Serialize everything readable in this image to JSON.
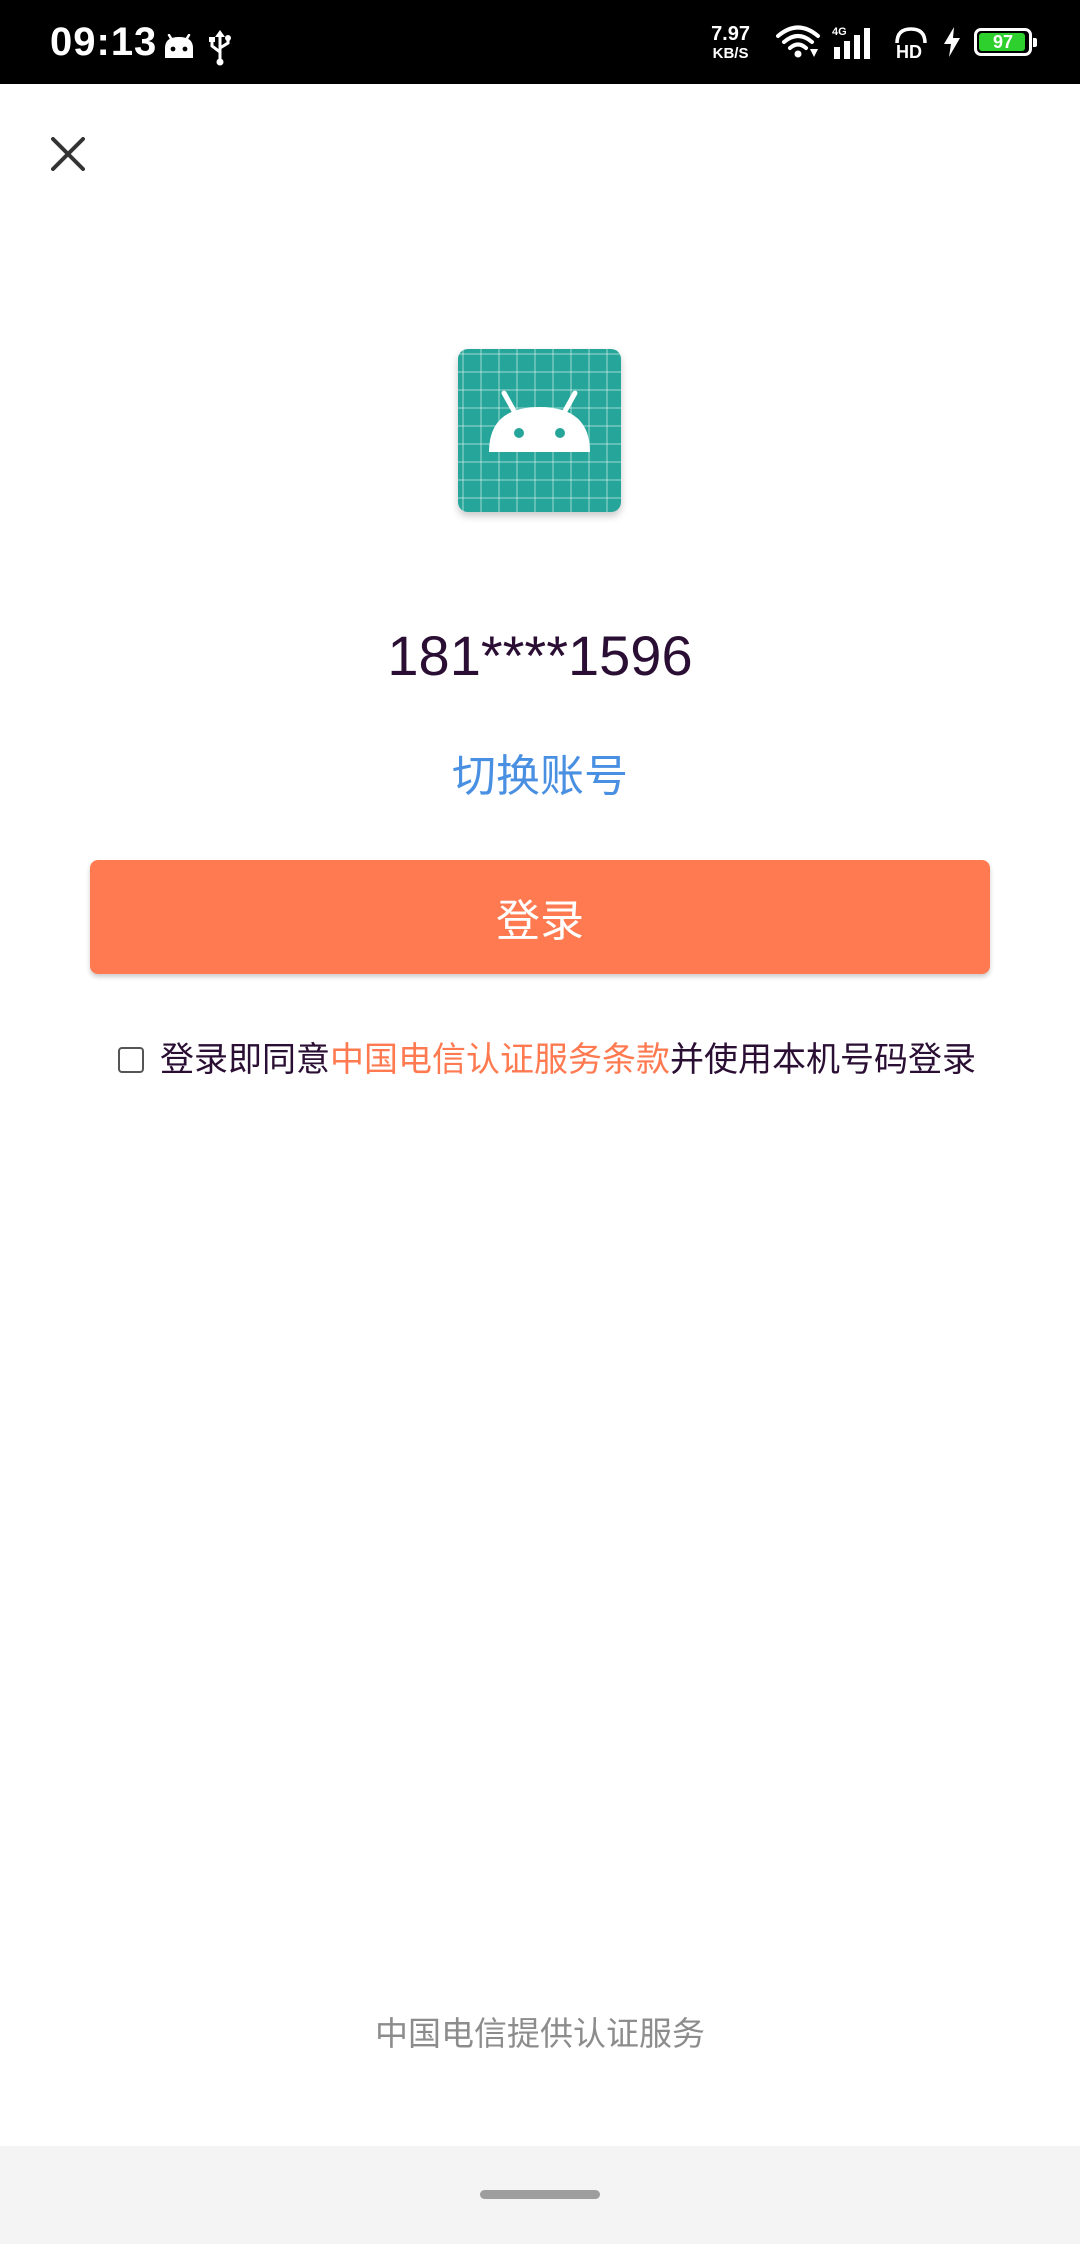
{
  "status_bar": {
    "time": "09:13",
    "net_speed_value": "7.97",
    "net_speed_unit": "KB/S",
    "network_type": "4G",
    "hd_label": "HD",
    "battery_level": "97",
    "battery_fraction": 0.97,
    "battery_color": "#2dd02d"
  },
  "header": {
    "close_icon": "close-icon"
  },
  "app": {
    "icon": "android-icon",
    "icon_color": "#26a69a"
  },
  "account": {
    "phone_number": "181****1596",
    "switch_label": "切换账号",
    "switch_color": "#4a90e2"
  },
  "login": {
    "button_label": "登录",
    "button_color": "#ff7a50"
  },
  "agreement": {
    "checked": false,
    "prefix": "登录即同意",
    "link_text": "中国电信认证服务条款",
    "suffix": "并使用本机号码登录",
    "link_color": "#ff7a50"
  },
  "footer": {
    "provider_text": "中国电信提供认证服务"
  }
}
